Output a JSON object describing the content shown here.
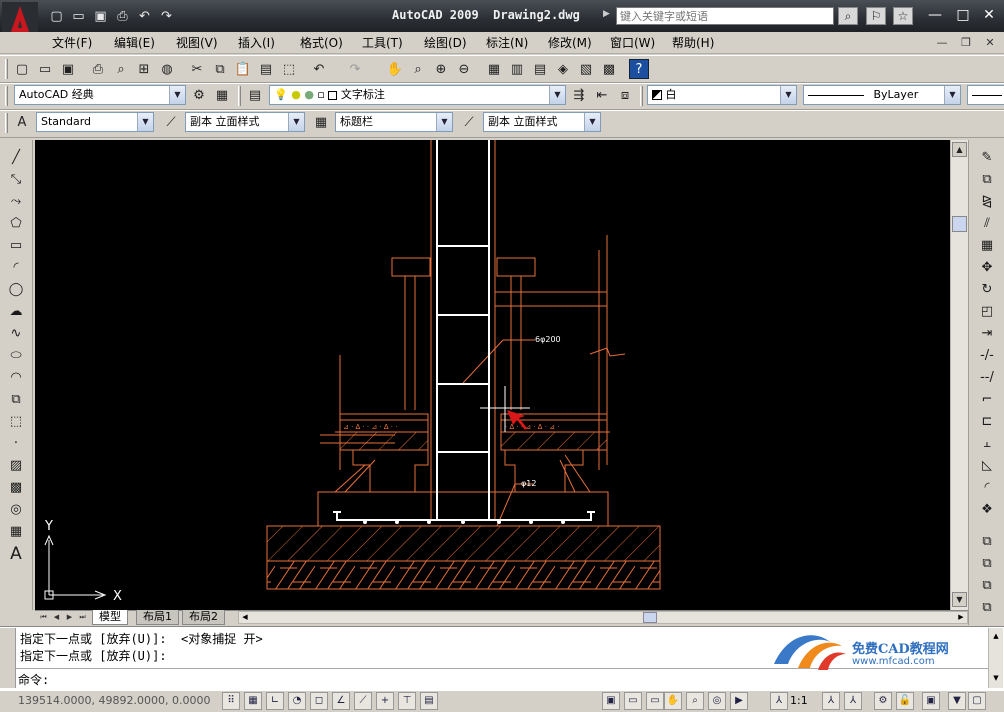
{
  "titlebar": {
    "title": "AutoCAD 2009  Drawing2.dwg",
    "search_placeholder": "键入关键字或短语"
  },
  "menu": {
    "items": [
      "文件(F)",
      "编辑(E)",
      "视图(V)",
      "插入(I)",
      "格式(O)",
      "工具(T)",
      "绘图(D)",
      "标注(N)",
      "修改(M)",
      "窗口(W)",
      "帮助(H)"
    ]
  },
  "toolbar2": {
    "workspace": "AutoCAD 经典",
    "layer": "文字标注",
    "color": "白",
    "linetype": "ByLayer"
  },
  "toolbar3": {
    "text_style": "Standard",
    "dim_style": "副本 立面样式",
    "table_style": "标题栏",
    "mleader_style": "副本 立面样式"
  },
  "drawing": {
    "label_rebar_top": "6φ200",
    "label_rebar_bottom": "φ12",
    "ucs_x": "X",
    "ucs_y": "Y"
  },
  "tabs": [
    "模型",
    "布局1",
    "布局2"
  ],
  "command": {
    "line1": "指定下一点或 [放弃(U)]:  <对象捕捉 开>",
    "line2": "指定下一点或 [放弃(U)]:",
    "prompt": "命令:"
  },
  "watermark": {
    "name": "免费CAD教程网",
    "url": "www.mfcad.com"
  },
  "status": {
    "coords": "139514.0000, 49892.0000, 0.0000",
    "scale": "1:1"
  },
  "colors": {
    "drawing_lines": "#e8703a",
    "canvas": "#000000",
    "walls": "#ffffff"
  }
}
